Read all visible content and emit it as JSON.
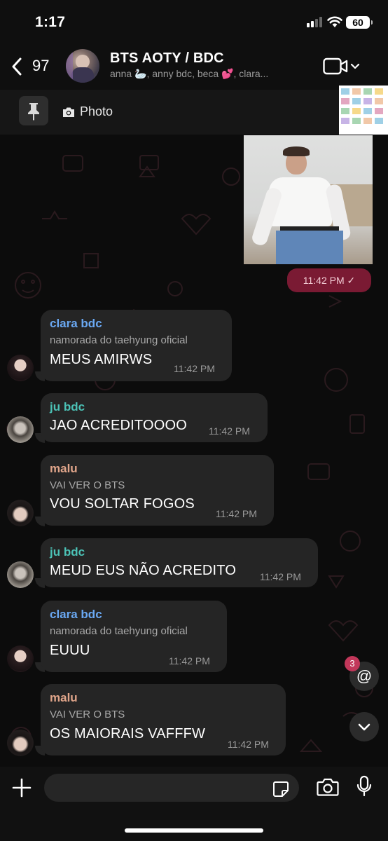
{
  "status_bar": {
    "time": "1:17",
    "battery": "60"
  },
  "header": {
    "back_count": "97",
    "title": "BTS AOTY / BDC",
    "members": "anna 🦢, anny bdc, beca 💕, clara..."
  },
  "pinned": {
    "label": "Photo"
  },
  "sent_photo": {
    "time": "11:42 PM ✓"
  },
  "messages": [
    {
      "sender": "clara bdc",
      "tag": "namorada do taehyung oficial",
      "text": "MEUS AMIRWS",
      "time": "11:42 PM",
      "color": "#6aa8f2"
    },
    {
      "sender": "ju bdc",
      "tag": "",
      "text": "JAO ACREDITOOOO",
      "time": "11:42 PM",
      "color": "#4cc2b6"
    },
    {
      "sender": "malu",
      "tag": "VAI VER O BTS",
      "text": "VOU SOLTAR FOGOS",
      "time": "11:42 PM",
      "color": "#e0a58a"
    },
    {
      "sender": "ju bdc",
      "tag": "",
      "text": "MEUD EUS NÃO ACREDITO",
      "time": "11:42 PM",
      "color": "#4cc2b6"
    },
    {
      "sender": "clara bdc",
      "tag": "namorada do taehyung oficial",
      "text": "EUUU",
      "time": "11:42 PM",
      "color": "#6aa8f2"
    },
    {
      "sender": "malu",
      "tag": "VAI VER O BTS",
      "text": "OS MAIORAIS VAFFFW",
      "time": "11:42 PM",
      "color": "#e0a58a"
    }
  ],
  "mentions": {
    "icon": "@",
    "count": "3"
  },
  "colors": {
    "sent_bubble": "#7a1a33",
    "received_bubble": "#252525",
    "background": "#0c0c0c"
  }
}
